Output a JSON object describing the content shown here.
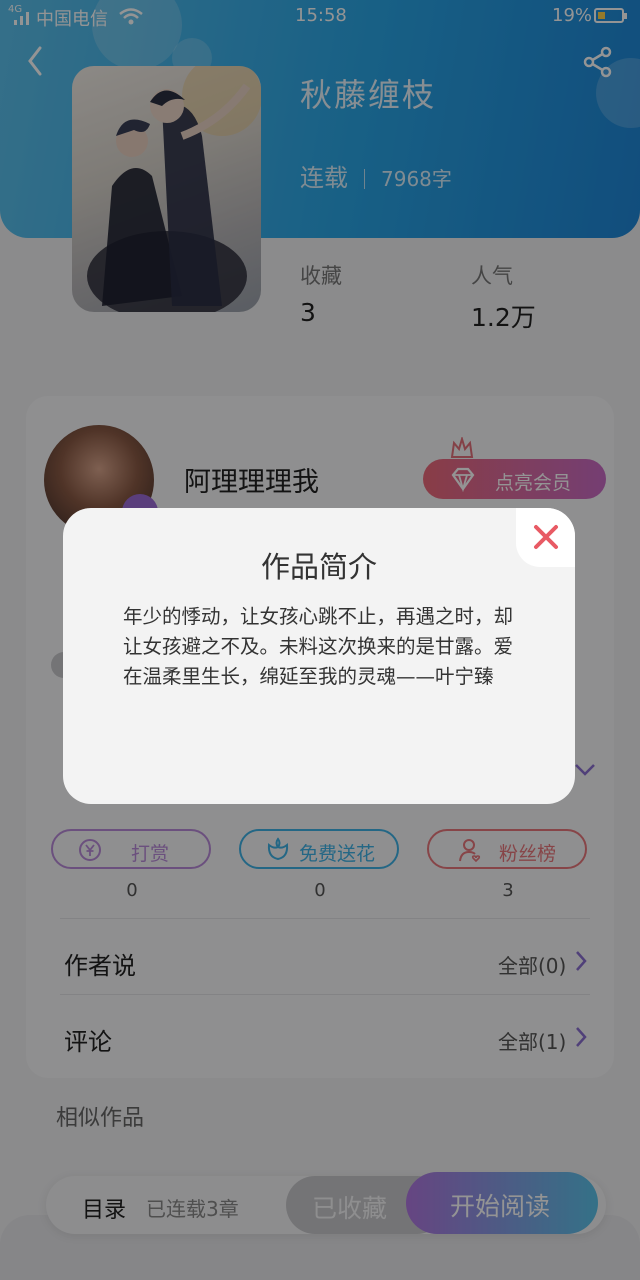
{
  "status_bar": {
    "network": "4G",
    "carrier": "中国电信",
    "time": "15:58",
    "battery": "19%"
  },
  "book": {
    "title": "秋藤缠枝",
    "status": "连载",
    "word_count": "7968字"
  },
  "stats": [
    {
      "label": "收藏",
      "value": "3"
    },
    {
      "label": "人气",
      "value": "1.2万"
    }
  ],
  "author": {
    "name": "阿理理理我",
    "vip_button": "点亮会员"
  },
  "actions": [
    {
      "label": "打赏",
      "count": "0",
      "color": "#b98ad9",
      "icon": "yen-coin-icon"
    },
    {
      "label": "免费送花",
      "count": "0",
      "color": "#3fb2e6",
      "icon": "flower-icon"
    },
    {
      "label": "粉丝榜",
      "count": "3",
      "color": "#e9777c",
      "icon": "fan-person-icon"
    }
  ],
  "rows": [
    {
      "label": "作者说",
      "right": "全部(0)"
    },
    {
      "label": "评论",
      "right": "全部(1)"
    }
  ],
  "similar_label": "相似作品",
  "bottom_bar": {
    "toc": "目录",
    "chapters": "已连载3章",
    "collected": "已收藏",
    "start": "开始阅读"
  },
  "modal": {
    "title": "作品简介",
    "body": "年少的悸动，让女孩心跳不止，再遇之时，却让女孩避之不及。未料这次换来的是甘露。爱在温柔里生长，绵延至我的灵魂——叶宁臻"
  },
  "colors": {
    "accent_blue": "#2aa6e6",
    "accent_purple": "#b077e0",
    "close_red": "#e85a64"
  }
}
